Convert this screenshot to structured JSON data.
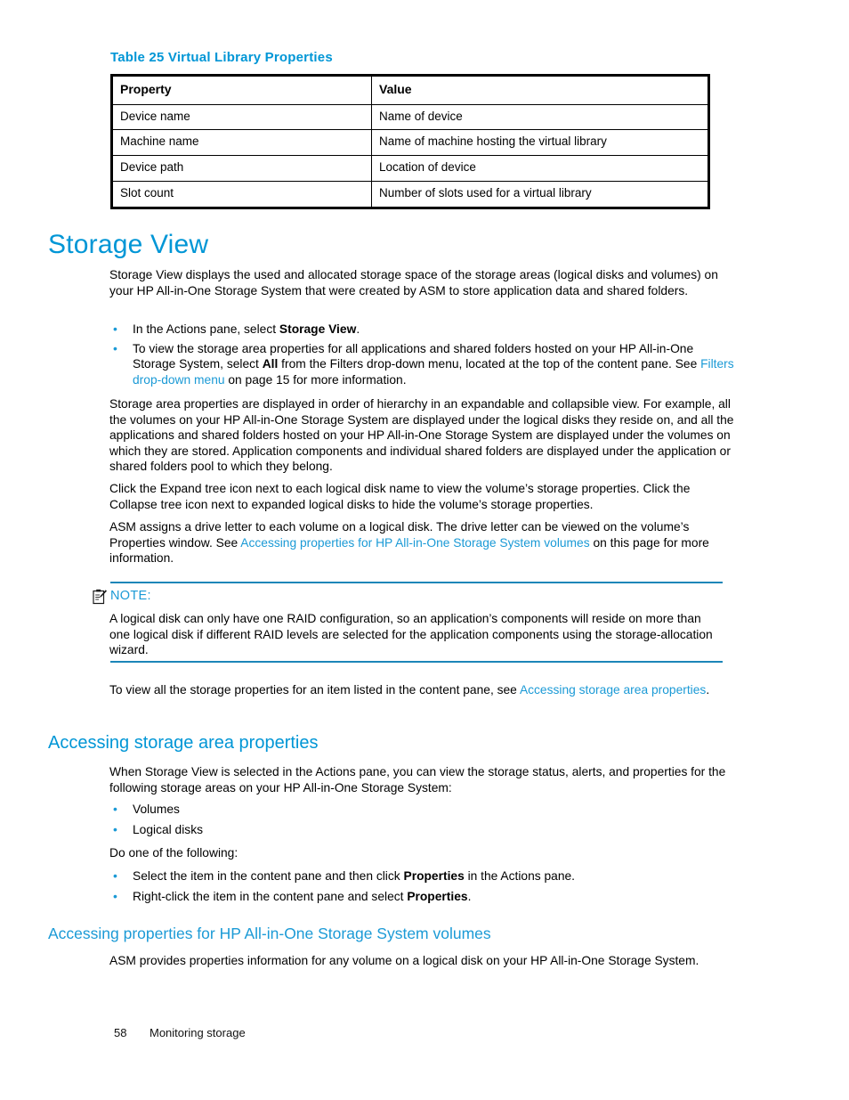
{
  "colors": {
    "accent_blue": "#0096d6",
    "link_blue": "#1b9ad6",
    "rule_blue": "#1b86b8",
    "text_black": "#000000"
  },
  "table": {
    "caption": "Table 25 Virtual Library Properties",
    "headers": [
      "Property",
      "Value"
    ],
    "rows": [
      [
        "Device name",
        "Name of device"
      ],
      [
        "Machine name",
        "Name of machine hosting the virtual library"
      ],
      [
        "Device path",
        "Location of device"
      ],
      [
        "Slot count",
        "Number of slots used for a virtual library"
      ]
    ]
  },
  "storage_view": {
    "heading": "Storage View",
    "intro": "Storage View displays the used and allocated storage space of the storage areas (logical disks and volumes) on your HP All-in-One Storage System that were created by ASM to store application data and shared folders.",
    "bullets": [
      {
        "pre": "In the Actions pane, select ",
        "bold": "Storage View",
        "post": "."
      },
      {
        "pre": "To view the storage area properties for all applications and shared folders hosted on your HP All-in-One Storage System, select ",
        "bold": "All",
        "post2a": " from the Filters drop-down menu, located at the top of the content pane. See ",
        "link": "Filters drop-down menu",
        "post2b": " on page 15 for more information."
      }
    ],
    "para_hierarchy": "Storage area properties are displayed in order of hierarchy in an expandable and collapsible view. For example, all the volumes on your HP All-in-One Storage System are displayed under the logical disks they reside on, and all the applications and shared folders hosted on your HP All-in-One Storage System are displayed under the volumes on which they are stored. Application components and individual shared folders are displayed under the application or shared folders pool to which they belong.",
    "para_expand": "Click the Expand tree icon next to each logical disk name to view the volume’s storage properties. Click the Collapse tree icon next to expanded logical disks to hide the volume’s storage properties.",
    "para_drive_pre": "ASM assigns a drive letter to each volume on a logical disk. The drive letter can be viewed on the volume’s Properties window. See ",
    "para_drive_link": "Accessing properties for HP All-in-One Storage System volumes",
    "para_drive_post": " on this page for more information."
  },
  "note": {
    "icon": "note-clipboard-icon",
    "label": "NOTE:",
    "body": "A logical disk can only have one RAID configuration, so an application’s components will reside on more than one logical disk if different RAID levels are selected for the application components using the storage-allocation wizard."
  },
  "after_note": {
    "pre": "To view all the storage properties for an item listed in the content pane, see ",
    "link": "Accessing storage area properties",
    "post": "."
  },
  "accessing_storage_area": {
    "heading": "Accessing storage area properties",
    "intro": "When Storage View is selected in the Actions pane, you can view the storage status, alerts, and properties for the following storage areas on your HP All-in-One Storage System:",
    "bullets": [
      "Volumes",
      "Logical disks"
    ],
    "do_one": "Do one of the following:",
    "action_bullets": [
      {
        "pre": "Select the item in the content pane and then click ",
        "bold": "Properties",
        "post": " in the Actions pane."
      },
      {
        "pre": "Right-click the item in the content pane and select ",
        "bold": "Properties",
        "post": "."
      }
    ]
  },
  "accessing_volumes": {
    "heading": "Accessing properties for HP All-in-One Storage System volumes",
    "body": "ASM provides properties information for any volume on a logical disk on your HP All-in-One Storage System."
  },
  "footer": {
    "page_number": "58",
    "chapter": "Monitoring storage"
  }
}
